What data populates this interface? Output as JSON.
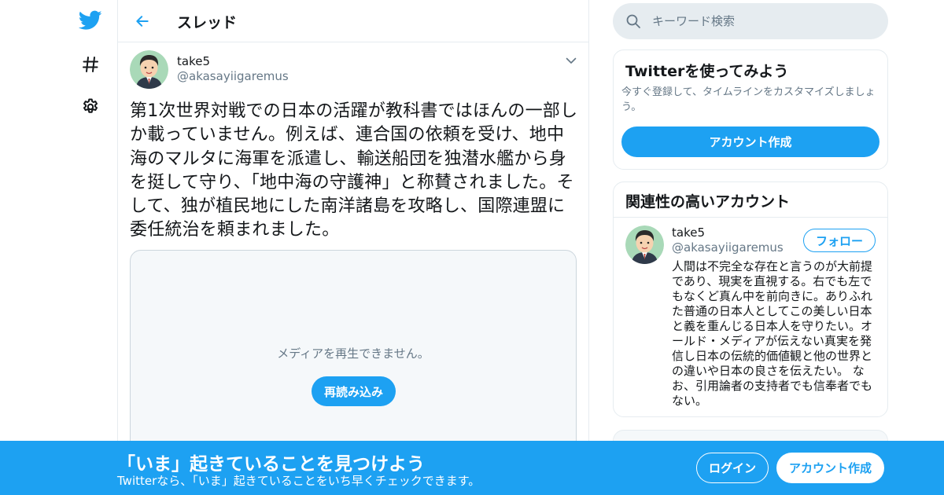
{
  "colors": {
    "accent": "#1da1f2",
    "text_primary": "#14171a",
    "text_secondary": "#657786",
    "border": "#e6ecf0"
  },
  "nav": {
    "items": [
      {
        "icon": "twitter-bird-icon"
      },
      {
        "icon": "hashtag-icon"
      },
      {
        "icon": "gear-icon"
      }
    ]
  },
  "header": {
    "back_icon": "arrow-left-icon",
    "title": "スレッド"
  },
  "tweet": {
    "author_name": "take5",
    "author_handle": "@akasayiigaremus",
    "text": "第1次世界対戦での日本の活躍が教科書ではほんの一部しか載っていません。例えば、連合国の依頼を受け、地中海のマルタに海軍を派遣し、輸送船団を独潜水艦から身を挺して守り、「地中海の守護神」と称賛されました。そして、独が植民地にした南洋諸島を攻略し、国際連盟に委任統治を頼まれました。",
    "media": {
      "message": "メディアを再生できません。",
      "reload_label": "再読み込み"
    }
  },
  "search": {
    "placeholder": "キーワード検索"
  },
  "signup_card": {
    "title": "Twitterを使ってみよう",
    "description": "今すぐ登録して、タイムラインをカスタマイズしましょう。",
    "button_label": "アカウント作成"
  },
  "related_card": {
    "title": "関連性の高いアカウント",
    "account": {
      "name": "take5",
      "handle": "@akasayiigaremus",
      "follow_label": "フォロー",
      "bio": "人間は不完全な存在と言うのが大前提であり、現実を直視する。右でも左でもなくど真ん中を前向きに。ありふれた普通の日本人としてこの美しい日本と義を重んじる日本人を守りたい。オールド・メディアが伝えない真実を発信し日本の伝統的価値観と他の世界との違いや日本の良さを伝えたい。 なお、引用論者の支持者でも信奉者でもない。"
    }
  },
  "bottom_bar": {
    "title": "「いま」起きていることを見つけよう",
    "subtitle": "Twitterなら、「いま」起きていることをいち早くチェックできます。",
    "login_label": "ログイン",
    "signup_label": "アカウント作成"
  }
}
